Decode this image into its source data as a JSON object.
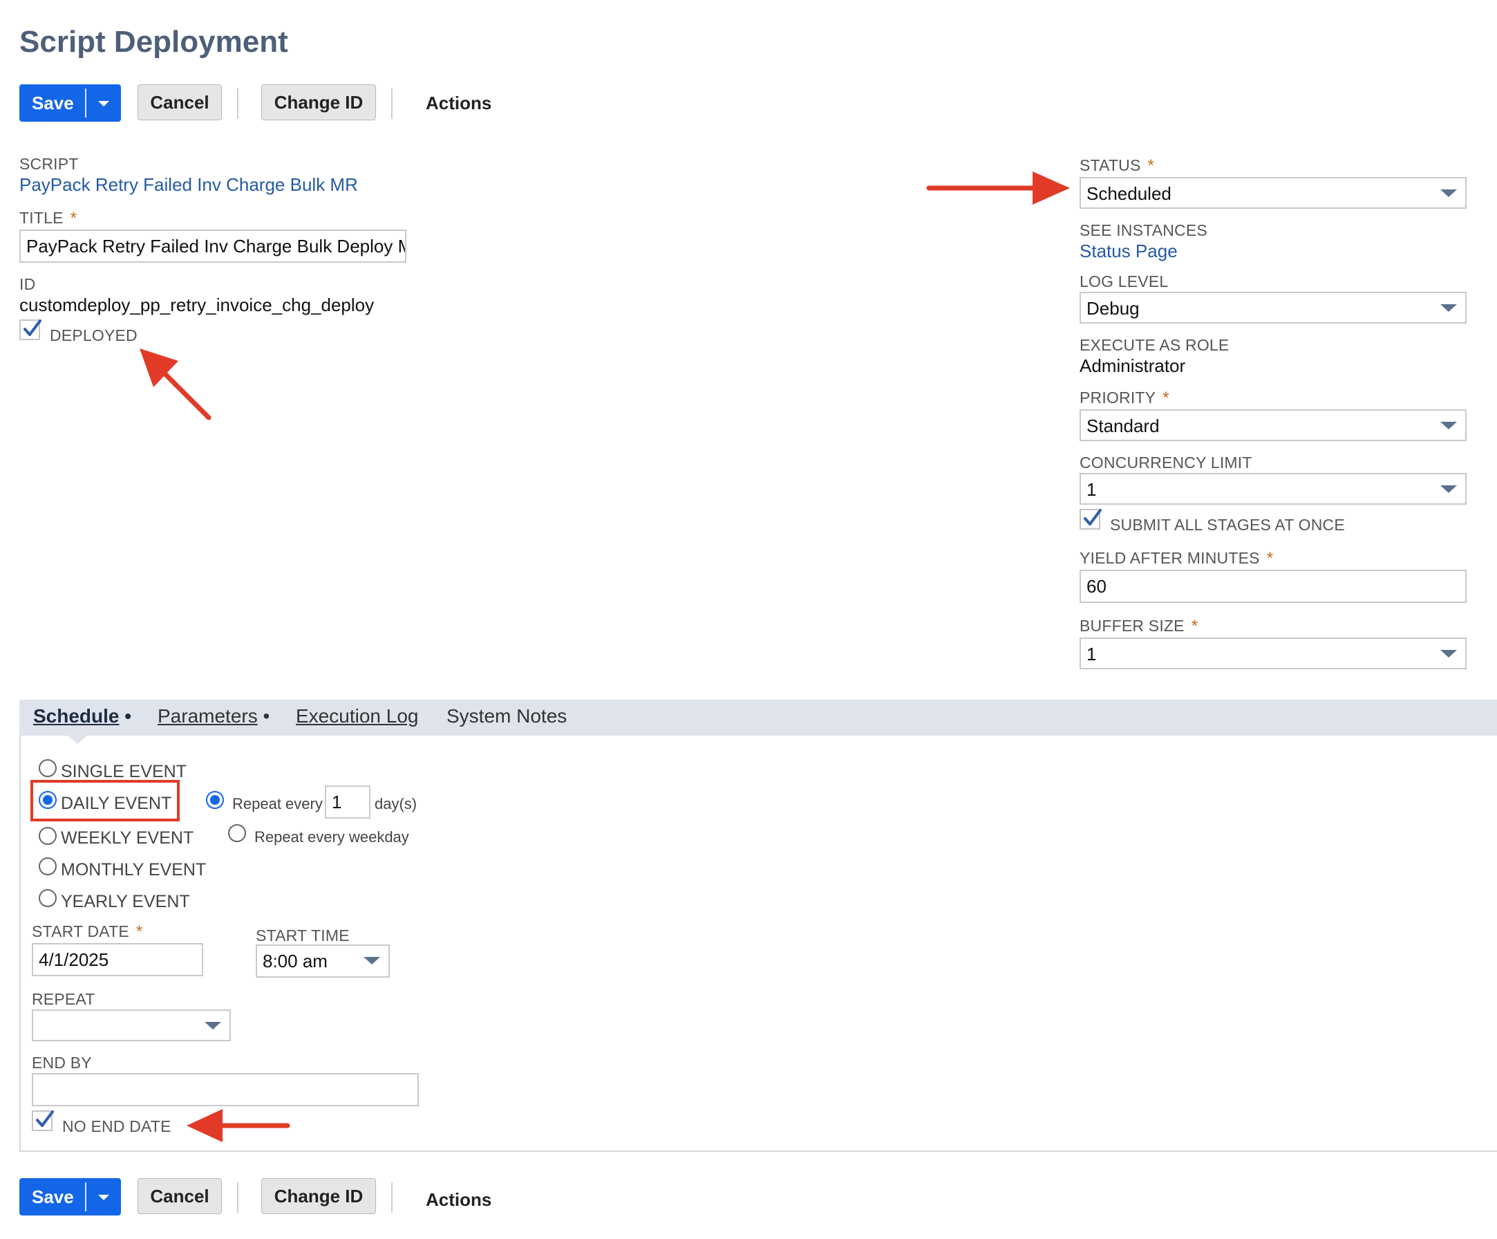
{
  "page": {
    "title": "Script Deployment"
  },
  "toolbar": {
    "save_label": "Save",
    "cancel_label": "Cancel",
    "change_id_label": "Change ID",
    "actions_label": "Actions"
  },
  "form": {
    "script": {
      "label": "SCRIPT",
      "value": "PayPack Retry Failed Inv Charge Bulk MR"
    },
    "title": {
      "label": "TITLE",
      "value": "PayPack Retry Failed Inv Charge Bulk Deploy MR"
    },
    "id": {
      "label": "ID",
      "value": "customdeploy_pp_retry_invoice_chg_deploy"
    },
    "deployed": {
      "label": "DEPLOYED",
      "checked": true
    },
    "status": {
      "label": "STATUS",
      "value": "Scheduled"
    },
    "see_instances": {
      "label": "SEE INSTANCES",
      "link": "Status Page"
    },
    "log_level": {
      "label": "LOG LEVEL",
      "value": "Debug"
    },
    "execute_as_role": {
      "label": "EXECUTE AS ROLE",
      "value": "Administrator"
    },
    "priority": {
      "label": "PRIORITY",
      "value": "Standard"
    },
    "concurrency_limit": {
      "label": "CONCURRENCY LIMIT",
      "value": "1"
    },
    "submit_all_stages": {
      "label": "SUBMIT ALL STAGES AT ONCE",
      "checked": true
    },
    "yield_after_minutes": {
      "label": "YIELD AFTER MINUTES",
      "value": "60"
    },
    "buffer_size": {
      "label": "BUFFER SIZE",
      "value": "1"
    },
    "required_mark": "*"
  },
  "tabs": [
    {
      "label": "Schedule",
      "active": true,
      "marker": "•"
    },
    {
      "label": "Parameters",
      "active": false,
      "marker": "•"
    },
    {
      "label": "Execution Log",
      "active": false,
      "marker": ""
    },
    {
      "label": "System Notes",
      "active": false,
      "marker": ""
    }
  ],
  "schedule": {
    "events": [
      {
        "label": "SINGLE EVENT",
        "selected": false
      },
      {
        "label": "DAILY EVENT",
        "selected": true
      },
      {
        "label": "WEEKLY EVENT",
        "selected": false
      },
      {
        "label": "MONTHLY EVENT",
        "selected": false
      },
      {
        "label": "YEARLY EVENT",
        "selected": false
      }
    ],
    "repeat_every_label": "Repeat every",
    "repeat_every_value": "1",
    "repeat_every_unit": "day(s)",
    "repeat_weekday_label": "Repeat every weekday",
    "start_date": {
      "label": "START DATE",
      "value": "4/1/2025"
    },
    "start_time": {
      "label": "START TIME",
      "value": "8:00 am"
    },
    "repeat": {
      "label": "REPEAT",
      "value": ""
    },
    "end_by": {
      "label": "END BY",
      "value": ""
    },
    "no_end_date": {
      "label": "NO END DATE",
      "checked": true
    }
  },
  "colors": {
    "accent": "#1466e8",
    "annotation": "#e13b27",
    "title": "#4d5f79",
    "link": "#255aa5"
  },
  "icons": [
    "chevron-down-icon",
    "checkmark-icon",
    "arrow-annotation-icon"
  ]
}
